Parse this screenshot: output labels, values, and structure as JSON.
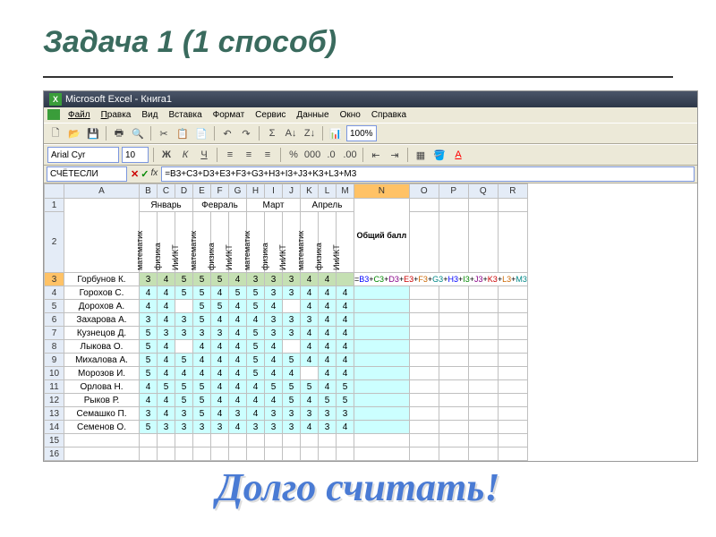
{
  "slide": {
    "title": "Задача 1 (1 способ)",
    "callout": "Долго считать!"
  },
  "window": {
    "title": "Microsoft Excel - Книга1"
  },
  "menu": [
    "Файл",
    "Правка",
    "Вид",
    "Вставка",
    "Формат",
    "Сервис",
    "Данные",
    "Окно",
    "Справка"
  ],
  "toolbar2": {
    "font": "Arial Cyr",
    "size": "10",
    "zoom": "100%"
  },
  "formula_bar": {
    "name_box": "СЧЁТЕСЛИ",
    "formula": "=B3+C3+D3+E3+F3+G3+H3+I3+J3+K3+L3+M3"
  },
  "columns": [
    "A",
    "B",
    "C",
    "D",
    "E",
    "F",
    "G",
    "H",
    "I",
    "J",
    "K",
    "L",
    "M",
    "N",
    "O",
    "P",
    "Q",
    "R"
  ],
  "months": [
    "Январь",
    "Февраль",
    "Март",
    "Апрель"
  ],
  "subjects": [
    "математик",
    "физика",
    "ИиИКТ"
  ],
  "total_label": "Общий балл",
  "rows": [
    {
      "n": 3,
      "name": "Горбунов К.",
      "v": [
        3,
        4,
        5,
        5,
        5,
        4,
        3,
        3,
        3,
        4,
        4
      ],
      "formula": "=B3+C3+D3+E3+F3+G3+H3+I3+J3+K3+L3+M3"
    },
    {
      "n": 4,
      "name": "Горохов С.",
      "v": [
        4,
        4,
        5,
        5,
        4,
        5,
        5,
        3,
        3,
        4,
        4,
        4
      ]
    },
    {
      "n": 5,
      "name": "Дорохов А.",
      "v": [
        4,
        4,
        "",
        5,
        5,
        4,
        5,
        4,
        "",
        4,
        4,
        4
      ]
    },
    {
      "n": 6,
      "name": "Захарова А.",
      "v": [
        3,
        4,
        3,
        5,
        4,
        4,
        4,
        3,
        3,
        3,
        4,
        4
      ]
    },
    {
      "n": 7,
      "name": "Кузнецов Д.",
      "v": [
        5,
        3,
        3,
        3,
        3,
        4,
        5,
        3,
        3,
        4,
        4,
        4
      ]
    },
    {
      "n": 8,
      "name": "Лыкова О.",
      "v": [
        5,
        4,
        "",
        4,
        4,
        4,
        5,
        4,
        "",
        4,
        4,
        4
      ]
    },
    {
      "n": 9,
      "name": "Михалова А.",
      "v": [
        5,
        4,
        5,
        4,
        4,
        4,
        5,
        4,
        5,
        4,
        4,
        4
      ]
    },
    {
      "n": 10,
      "name": "Морозов И.",
      "v": [
        5,
        4,
        4,
        4,
        4,
        4,
        5,
        4,
        4,
        "",
        4,
        4
      ]
    },
    {
      "n": 11,
      "name": "Орлова Н.",
      "v": [
        4,
        5,
        5,
        5,
        4,
        4,
        4,
        5,
        5,
        5,
        4,
        5
      ]
    },
    {
      "n": 12,
      "name": "Рыков Р.",
      "v": [
        4,
        4,
        5,
        5,
        4,
        4,
        4,
        4,
        5,
        4,
        5,
        5
      ]
    },
    {
      "n": 13,
      "name": "Семашко П.",
      "v": [
        3,
        4,
        3,
        5,
        4,
        3,
        4,
        3,
        3,
        3,
        3,
        3
      ]
    },
    {
      "n": 14,
      "name": "Семенов О.",
      "v": [
        5,
        3,
        3,
        3,
        3,
        4,
        3,
        3,
        3,
        4,
        3,
        4
      ]
    }
  ],
  "empty_rows": [
    15,
    16
  ]
}
